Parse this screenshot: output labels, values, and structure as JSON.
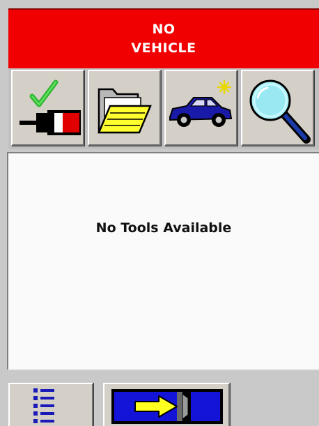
{
  "banner": {
    "line1": "NO",
    "line2": "VEHICLE",
    "color": "#f00000"
  },
  "toolbar": {
    "buttons": [
      {
        "icon": "vehicle-connection-check-icon"
      },
      {
        "icon": "open-folder-icon"
      },
      {
        "icon": "new-vehicle-icon"
      },
      {
        "icon": "magnifier-icon"
      }
    ]
  },
  "panel": {
    "message": "No Tools Available"
  },
  "bottom": {
    "buttons": [
      {
        "icon": "list-icon"
      },
      {
        "icon": "forward-arrow-icon"
      }
    ]
  }
}
